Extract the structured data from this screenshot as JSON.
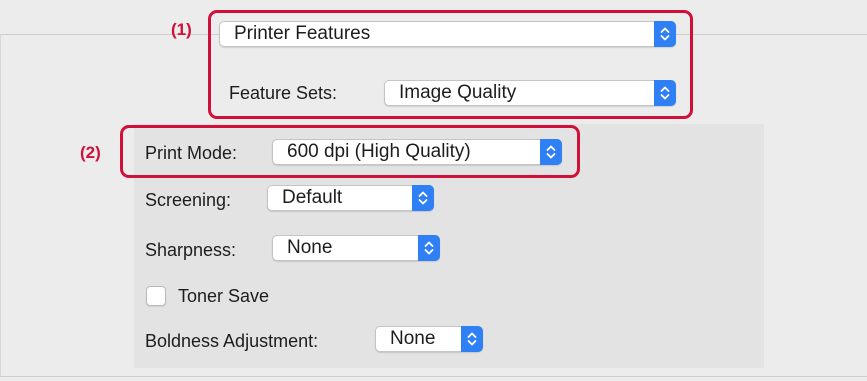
{
  "callouts": {
    "one": "(1)",
    "two": "(2)"
  },
  "printer_features": {
    "menu_value": "Printer Features",
    "feature_sets_label": "Feature Sets:",
    "feature_sets_value": "Image Quality"
  },
  "image_quality": {
    "print_mode_label": "Print Mode:",
    "print_mode_value": "600 dpi (High Quality)",
    "screening_label": "Screening:",
    "screening_value": "Default",
    "sharpness_label": "Sharpness:",
    "sharpness_value": "None",
    "toner_save_label": "Toner Save",
    "toner_save_checked": false,
    "boldness_label": "Boldness Adjustment:",
    "boldness_value": "None"
  },
  "colors": {
    "callout": "#d0103a",
    "stepper": "#2f7ff5"
  },
  "icons": [
    "up-down-chevron-icon"
  ]
}
